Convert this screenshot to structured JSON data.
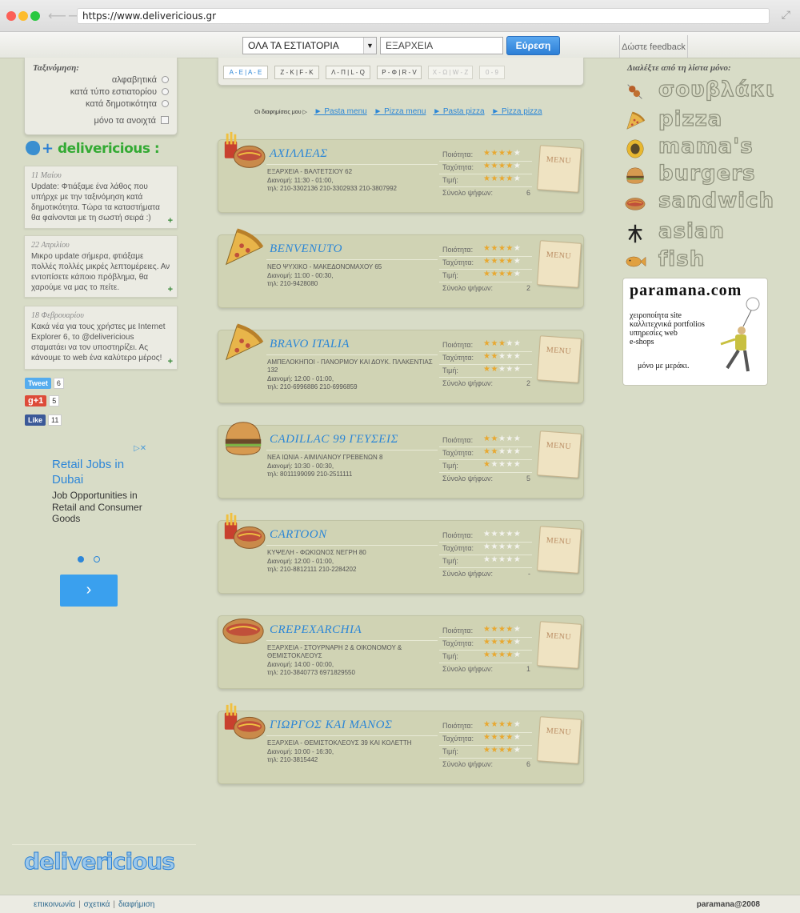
{
  "browser": {
    "url": "https://www.delivericious.gr"
  },
  "topbar": {
    "restaurants_select": "ΟΛΑ ΤΑ ΕΣΤΙΑΤΟΡΙΑ",
    "area_input": "ΕΞΑΡΧΕΙΑ",
    "find_button": "Εύρεση",
    "feedback": "Δώστε feedback"
  },
  "sort": {
    "title": "Ταξινόμηση:",
    "options": [
      "αλφαβητικά",
      "κατά τύπο εστιατορίου",
      "κατά δημοτικότητα"
    ],
    "only_open": "μόνο τα ανοιχτά"
  },
  "twitter": {
    "plus": "+",
    "brand": "delivericious",
    "colon": ":"
  },
  "news": [
    {
      "date": "11 Μαίου",
      "text": "Update: Φτιάξαμε ένα λάθος που υπήρχε με την ταξινόμηση κατά δημοτικότητα. Τώρα τα καταστήματα θα φαίνονται με τη σωστή σειρά :)"
    },
    {
      "date": "22 Απριλίου",
      "text": "Μικρο update σήμερα, φτιάξαμε πολλές πολλές μικρές λεπτομέρειες. Αν εντοπίσετε κάποιο πρόβλημα, θα χαρούμε να μας το πείτε."
    },
    {
      "date": "18 Φεβρουαρίου",
      "text": "Κακά νέα για τους χρήστες με Internet Explorer 6, το @delivericious σταματάει να τον υποστηρίζει. Ας κάνουμε το web ένα καλύτερο μέρος!"
    }
  ],
  "news_more": "+",
  "social": {
    "tweet_label": "Tweet",
    "tweet_count": "6",
    "gplus_label": "g+1",
    "gplus_count": "5",
    "like_label": "Like",
    "like_count": "11"
  },
  "ad": {
    "adchoices": "▷✕",
    "headline": "Retail Jobs in Dubai",
    "body": "Job Opportunities in Retail and Consumer Goods",
    "button": "›"
  },
  "alphabet": [
    "Α - Ε | Α - Ε",
    "Ζ - Κ | F - Κ",
    "Λ - Π | L - Q",
    "Ρ - Φ | R - V",
    "Χ - Ω | W - Z",
    "0 - 9"
  ],
  "favorites": {
    "label": "Οι διαφημίσεις μου ▷",
    "links": [
      "► Pasta menu",
      "► Pizza menu",
      "► Pasta pizza",
      "► Pizza pizza"
    ]
  },
  "rating_labels": {
    "quality": "Ποιότητα:",
    "speed": "Ταχύτητα:",
    "price": "Τιμή:",
    "votes": "Σύνολο ψήφων:"
  },
  "menu_label": "MENU",
  "restaurants": [
    {
      "name": "ΑΧΙΛΛΕΑΣ",
      "icon": "fries-hotdog-icon",
      "address": "ΕΞΑΡΧΕΙΑ - ΒΑΛΤΕΤΣΙΟΥ 62",
      "hours": "Διανομή: 11:30 - 01:00,",
      "tel": "τηλ: 210-3302136  210-3302933  210-3807992",
      "quality": 4,
      "speed": 4,
      "price": 4,
      "votes": "6"
    },
    {
      "name": "BENVENUTO",
      "icon": "pizza-icon",
      "address": "ΝΕΟ ΨΥΧΙΚΟ - ΜΑΚΕΔΟΝΟΜΑΧΟΥ 65",
      "hours": "Διανομή: 11:00 - 00:30,",
      "tel": "τηλ: 210-9428080",
      "quality": 4,
      "speed": 4,
      "price": 4,
      "votes": "2"
    },
    {
      "name": "BRAVO ITALIA",
      "icon": "pizza-icon",
      "address": "ΑΜΠΕΛΟΚΗΠΟΙ - ΠΑΝΟΡΜΟΥ ΚΑΙ ΔΟΥΚ. ΠΛΑΚΕΝΤΙΑΣ 132",
      "hours": "Διανομή: 12:00 - 01:00,",
      "tel": "τηλ: 210-6996886  210-6996859",
      "quality": 3,
      "speed": 2,
      "price": 2,
      "votes": "2"
    },
    {
      "name": "CADILLAC 99 ΓΕΥΣΕΙΣ",
      "icon": "burger-icon",
      "address": "ΝΕΑ ΙΩΝΙΑ - ΑΙΜΙΛΙΑΝΟΥ ΓΡΕΒΕΝΩΝ 8",
      "hours": "Διανομή: 10:30 - 00:30,",
      "tel": "τηλ: 8011199099  210-2511111",
      "quality": 2,
      "speed": 2,
      "price": 1,
      "votes": "5"
    },
    {
      "name": "CARTOON",
      "icon": "fries-hotdog-icon",
      "address": "ΚΥΨΕΛΗ - ΦΩΚΙΩΝΟΣ ΝΕΓΡΗ 80",
      "hours": "Διανομή: 12:00 - 01:00,",
      "tel": "τηλ: 210-8812111  210-2284202",
      "quality": 0,
      "speed": 0,
      "price": 0,
      "votes": "-"
    },
    {
      "name": "CREPEXARCHIA",
      "icon": "sandwich-icon",
      "address": "ΕΞΑΡΧΕΙΑ - ΣΤΟΥΡΝΑΡΗ 2 & ΟΙΚΟΝΟΜΟΥ & ΘΕΜΙΣΤΟΚΛΕΟΥΣ",
      "hours": "Διανομή: 14:00 - 00:00,",
      "tel": "τηλ: 210-3840773  6971829550",
      "quality": 4,
      "speed": 4,
      "price": 4,
      "votes": "1"
    },
    {
      "name": "ΓΙΩΡΓΟΣ ΚΑΙ ΜΑΝΟΣ",
      "icon": "fries-hotdog-icon",
      "address": "ΕΞΑΡΧΕΙΑ - ΘΕΜΙΣΤΟΚΛΕΟΥΣ 39 ΚΑΙ ΚΟΛΕΤΤΗ",
      "hours": "Διανομή: 10:00 - 16:30,",
      "tel": "τηλ: 210-3815442",
      "quality": 4,
      "speed": 4,
      "price": 4,
      "votes": "6"
    }
  ],
  "right": {
    "pick_title": "Διαλέξτε από τη λίστα μόνο:",
    "categories": [
      {
        "label": "σουβλάκι",
        "icon": "souvlaki-icon"
      },
      {
        "label": "pizza",
        "icon": "pizza-icon"
      },
      {
        "label": "mama's",
        "icon": "mamas-icon"
      },
      {
        "label": "burgers",
        "icon": "burger-icon"
      },
      {
        "label": "sandwich",
        "icon": "sandwich-icon"
      },
      {
        "label": "asian",
        "icon": "asian-icon"
      },
      {
        "label": "fish",
        "icon": "fish-icon"
      }
    ],
    "paramana": {
      "logo": "paramana.com",
      "lines": [
        "χειροποίητα site",
        "καλλιτεχνικά portfolios",
        "υπηρεσίες web",
        "e-shops"
      ],
      "bottom": "μόνο με μεράκι."
    }
  },
  "footer": {
    "logo": "delivericious",
    "links": [
      "επικοινωνία",
      "σχετικά",
      "διαφήμιση"
    ],
    "copyright": "paramana@2008"
  },
  "colors": {
    "accent": "#2b86d6",
    "background": "#d8dcc7",
    "card": "#d0d3b4",
    "star": "#e8a830"
  }
}
